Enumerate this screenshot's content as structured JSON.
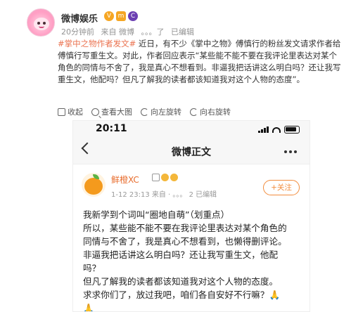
{
  "post": {
    "account_name": "微博娱乐",
    "badges": [
      "V",
      "m",
      "C"
    ],
    "time": "20分钟前",
    "source_label": "来自 微博",
    "source_suffix": "。。。了",
    "edited": "已编辑",
    "hashtag": "#掌中之物作者发文#",
    "body": " 近日，有不少《掌中之物》傅慎行的粉丝发文请求作者给傅慎行写重生文。对此，作者回应表示“某些能不能不要在我评论里表达对某个角色的同情与不舍了，我是真心不想看到。非逼我把话讲这么明白吗？还让我写重生文，他配吗？但凡了解我的读者都该知道我对这个人物的态度”。",
    "toolbar": {
      "collapse": "收起",
      "view_large": "查看大图",
      "rotate_left": "向左旋转",
      "rotate_right": "向右旋转"
    }
  },
  "screenshot": {
    "status_time": "20:11",
    "nav_title": "微博正文",
    "inner_post": {
      "name": "鲜橙XC",
      "meta": "1-12 23:13 来自 · 。。。 2 已编辑",
      "follow_label": "+关注",
      "lines": [
        "我新学到个词叫“圈地自萌”（划重点）",
        "所以，某些能不能不要在我评论里表达对某个角色的",
        "同情与不舍了，我是真心不想看到，也懒得删评论。",
        "非逼我把话讲这么明白吗？还让我写重生文，他配",
        "吗？",
        "但凡了解我的读者都该知道我对这个人物的态度。",
        "求求你们了，放过我吧，咱们各自安好不行嘛？🙏",
        "🙏"
      ]
    }
  },
  "colors": {
    "hashtag": "#eb7350",
    "inner_name": "#e86c2c",
    "follow": "#f28c3c"
  }
}
